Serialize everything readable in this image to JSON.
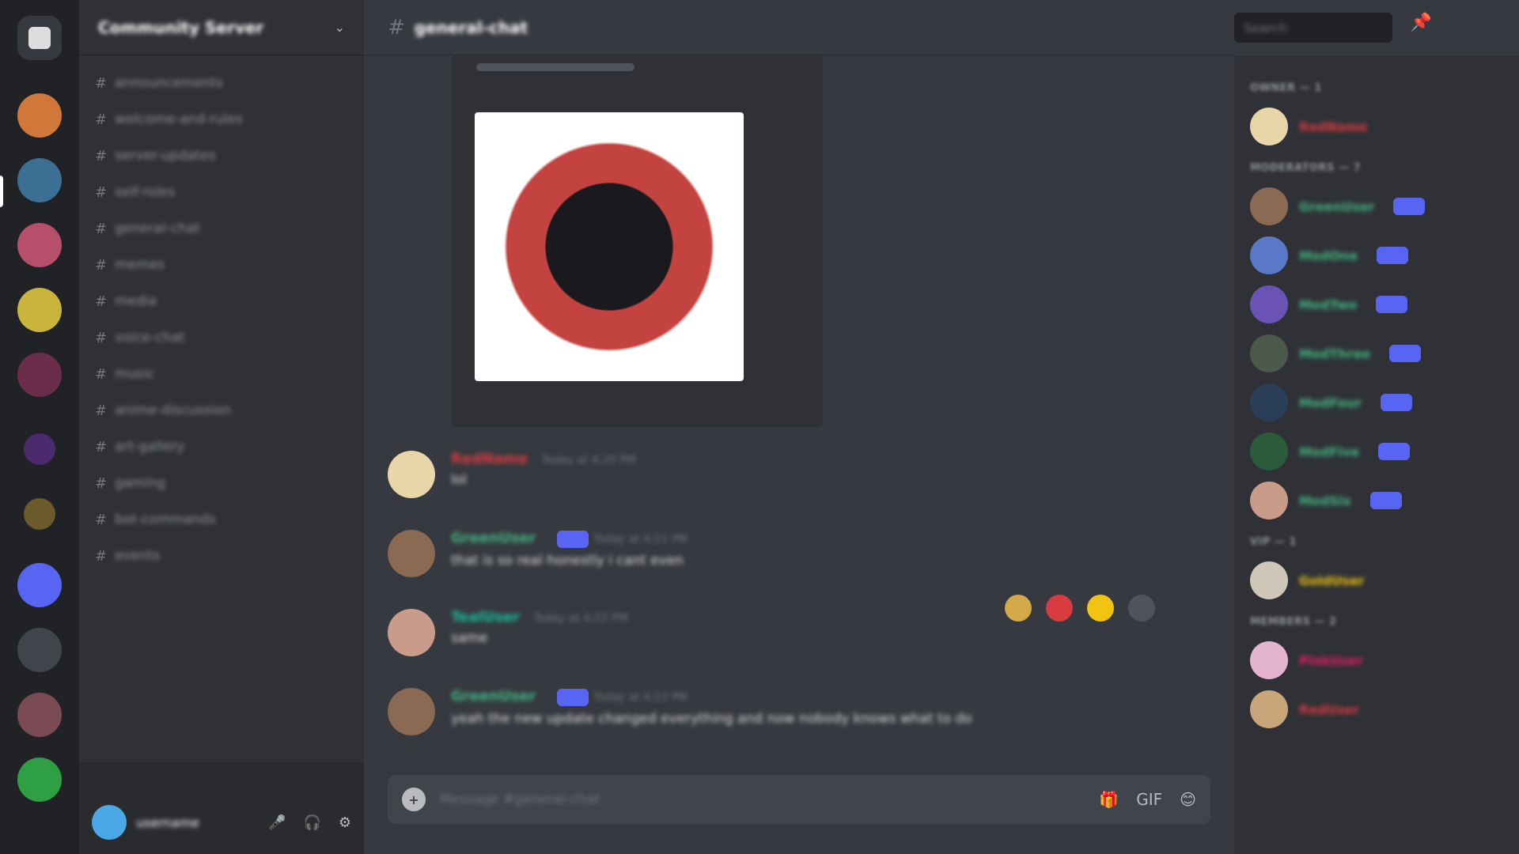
{
  "guild": {
    "name": "Community Server",
    "chevron": "⌄"
  },
  "channels": [
    {
      "name": "announcements"
    },
    {
      "name": "welcome-and-rules"
    },
    {
      "name": "server-updates"
    },
    {
      "name": "self-roles"
    },
    {
      "name": "general-chat"
    },
    {
      "name": "memes"
    },
    {
      "name": "media"
    },
    {
      "name": "voice-chat"
    },
    {
      "name": "music"
    },
    {
      "name": "anime-discussion"
    },
    {
      "name": "art-gallery"
    },
    {
      "name": "gaming"
    },
    {
      "name": "bot-commands"
    },
    {
      "name": "events"
    }
  ],
  "user_panel": {
    "username": "username",
    "actions": [
      "🎤",
      "🎧",
      "⚙"
    ]
  },
  "chat": {
    "channel_name": "general-chat",
    "search_placeholder": "Search"
  },
  "messages": [
    {
      "author": "RedName",
      "time": "Today at 4:20 PM",
      "text": "lol",
      "color": "#d83c3e"
    },
    {
      "author": "GreenUser",
      "time": "Today at 4:21 PM",
      "text": "that is so real honestly i cant even",
      "color": "#43b581"
    },
    {
      "author": "TealUser",
      "time": "Today at 4:22 PM",
      "text": "same",
      "color": "#1abc9c"
    },
    {
      "author": "GreenUser",
      "time": "Today at 4:23 PM",
      "text": "yeah the new update changed everything and now nobody knows what to do",
      "color": "#43b581"
    }
  ],
  "composer": {
    "placeholder": "Message #general-chat",
    "icons": [
      "🎁",
      "GIF",
      "😊"
    ]
  },
  "members": {
    "roles": [
      {
        "name": "OWNER — 1",
        "users": [
          {
            "name": "RedName",
            "color": "#d83c3e"
          }
        ]
      },
      {
        "name": "MODERATORS — 7",
        "users": [
          {
            "name": "GreenUser",
            "color": "#43b581"
          },
          {
            "name": "ModOne",
            "color": "#43b581"
          },
          {
            "name": "ModTwo",
            "color": "#43b581"
          },
          {
            "name": "ModThree",
            "color": "#43b581"
          },
          {
            "name": "ModFour",
            "color": "#43b581"
          },
          {
            "name": "ModFive",
            "color": "#43b581"
          },
          {
            "name": "ModSix",
            "color": "#43b581"
          }
        ]
      },
      {
        "name": "VIP — 1",
        "users": [
          {
            "name": "GoldUser",
            "color": "#f1c40f"
          }
        ]
      },
      {
        "name": "MEMBERS — 2",
        "users": [
          {
            "name": "PinkUser",
            "color": "#e91e63"
          },
          {
            "name": "RedUser",
            "color": "#d83c3e"
          }
        ]
      }
    ]
  },
  "colors": {
    "bg_main": "#36393f",
    "bg_sidebar": "#2f3136",
    "bg_rail": "#202225",
    "accent": "#5865f2"
  }
}
